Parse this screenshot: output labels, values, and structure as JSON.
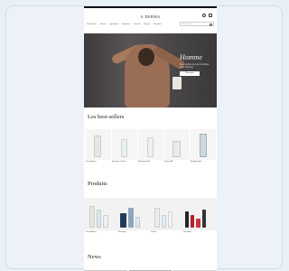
{
  "header": {
    "logo": "A·DERMA",
    "nav": [
      "Nos produits",
      "Besoin",
      "Ingrédients",
      "Expertise",
      "Conseils",
      "Marque",
      "Actualités"
    ],
    "search_placeholder": "Rechercher"
  },
  "hero": {
    "title": "Homme",
    "subtitle": "Une routine de soin complète pour l'homme",
    "button": "Découvrir"
  },
  "sections": {
    "bestsellers_title": "Les best-sellers",
    "bestsellers": [
      {
        "name": "Dermalibour+"
      },
      {
        "name": "Exomega Control"
      },
      {
        "name": "Epitheliale A.H"
      },
      {
        "name": "Protect AD"
      },
      {
        "name": "Biology Hydra"
      }
    ],
    "products_title": "Produits",
    "products": [
      {
        "caption": "Dermalibour+"
      },
      {
        "caption": "Exomega"
      },
      {
        "caption": "Protect"
      },
      {
        "caption": "Sensifluid"
      }
    ],
    "news_title": "News"
  },
  "colors": {
    "accent": "#111111",
    "hero_bg": "#4a4748"
  }
}
